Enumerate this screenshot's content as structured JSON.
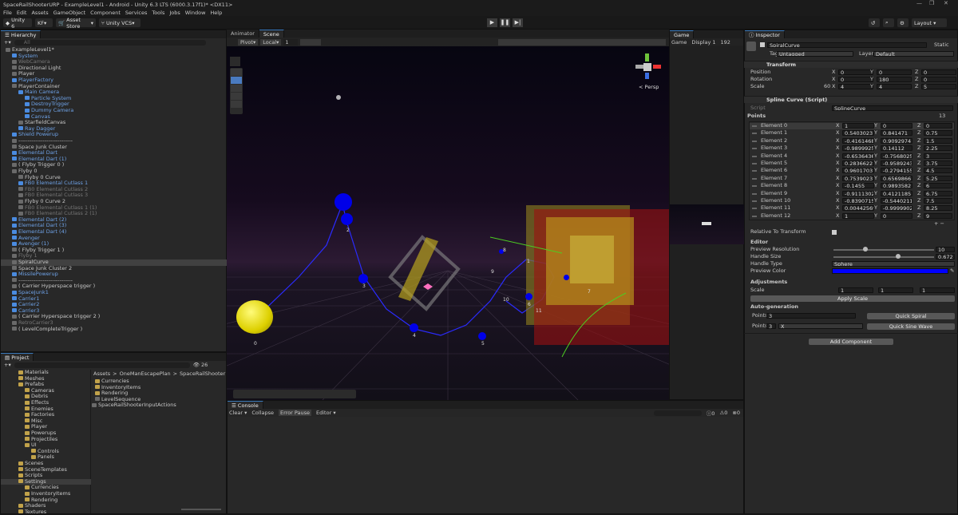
{
  "window": {
    "title": "SpaceRailShooterURP - ExampleLevel1 - Android - Unity 6.3 LTS (6000.3.17f1)* <DX11>"
  },
  "menu": [
    "File",
    "Edit",
    "Assets",
    "GameObject",
    "Component",
    "Services",
    "Tools",
    "Jobs",
    "Window",
    "Help"
  ],
  "toolbar": {
    "unity": "Unity 6",
    "kf": "KF",
    "asset_store": "Asset Store",
    "vcs": "Unity VCS",
    "layout": "Layout"
  },
  "hierarchy": {
    "tab": "Hierarchy",
    "search_placeholder": "All",
    "items": [
      {
        "t": "ExampleLevel1*",
        "d": 0,
        "c": "w"
      },
      {
        "t": "System",
        "d": 1,
        "c": "b"
      },
      {
        "t": "WebCamera",
        "d": 1,
        "c": "g"
      },
      {
        "t": "Directional Light",
        "d": 1,
        "c": "w"
      },
      {
        "t": "Player",
        "d": 1,
        "c": "w"
      },
      {
        "t": "PlayerFactory",
        "d": 1,
        "c": "b"
      },
      {
        "t": "PlayerContainer",
        "d": 1,
        "c": "w"
      },
      {
        "t": "Main Camera",
        "d": 2,
        "c": "b"
      },
      {
        "t": "Particle System",
        "d": 3,
        "c": "b"
      },
      {
        "t": "DestroyTrigger",
        "d": 3,
        "c": "b"
      },
      {
        "t": "Dummy Camera",
        "d": 3,
        "c": "b"
      },
      {
        "t": "Canvas",
        "d": 3,
        "c": "b"
      },
      {
        "t": "StarfieldCanvas",
        "d": 2,
        "c": "w"
      },
      {
        "t": "Ray Dagger",
        "d": 2,
        "c": "b"
      },
      {
        "t": "Shield Powerup",
        "d": 1,
        "c": "b"
      },
      {
        "t": "-----------------------------",
        "d": 1,
        "c": "w"
      },
      {
        "t": "Space Junk Cluster",
        "d": 1,
        "c": "w"
      },
      {
        "t": "Elemental Dart",
        "d": 1,
        "c": "b"
      },
      {
        "t": "Elemental Dart (1)",
        "d": 1,
        "c": "b"
      },
      {
        "t": "( Flyby Trigger 0 )",
        "d": 1,
        "c": "w"
      },
      {
        "t": "Flyby 0",
        "d": 1,
        "c": "w"
      },
      {
        "t": "Flyby 0 Curve",
        "d": 2,
        "c": "w"
      },
      {
        "t": "FB0 Elemental Cutlass 1",
        "d": 2,
        "c": "b"
      },
      {
        "t": "FB0 Elemental Cutlass 2",
        "d": 2,
        "c": "g"
      },
      {
        "t": "FB0 Elemental Cutlass 3",
        "d": 2,
        "c": "g"
      },
      {
        "t": "Flyby 0 Curve 2",
        "d": 2,
        "c": "w"
      },
      {
        "t": "FB0 Elemental Cutlass 1 (1)",
        "d": 2,
        "c": "g"
      },
      {
        "t": "FB0 Elemental Cutlass 2 (1)",
        "d": 2,
        "c": "g"
      },
      {
        "t": "Elemental Dart (2)",
        "d": 1,
        "c": "b"
      },
      {
        "t": "Elemental Dart (3)",
        "d": 1,
        "c": "b"
      },
      {
        "t": "Elemental Dart (4)",
        "d": 1,
        "c": "b"
      },
      {
        "t": "Avenger",
        "d": 1,
        "c": "b"
      },
      {
        "t": "Avenger (1)",
        "d": 1,
        "c": "b"
      },
      {
        "t": "( Flyby Trigger 1 )",
        "d": 1,
        "c": "w"
      },
      {
        "t": "Flyby 1",
        "d": 1,
        "c": "g"
      },
      {
        "t": "SpiralCurve",
        "d": 1,
        "c": "w",
        "sel": true
      },
      {
        "t": "Space Junk Cluster 2",
        "d": 1,
        "c": "w"
      },
      {
        "t": "MissilePowerup",
        "d": 1,
        "c": "b"
      },
      {
        "t": "-----------------------------",
        "d": 1,
        "c": "w"
      },
      {
        "t": "( Carrier Hyperspace trigger )",
        "d": 1,
        "c": "w"
      },
      {
        "t": "SpaceJunk1",
        "d": 1,
        "c": "b"
      },
      {
        "t": "Carrier1",
        "d": 1,
        "c": "b"
      },
      {
        "t": "Carrier2",
        "d": 1,
        "c": "b"
      },
      {
        "t": "Carrier3",
        "d": 1,
        "c": "b"
      },
      {
        "t": "( Carrier Hyperspace trigger 2 )",
        "d": 1,
        "c": "w"
      },
      {
        "t": "RetroCarrier3",
        "d": 1,
        "c": "g"
      },
      {
        "t": "( LevelCompleteTrigger )",
        "d": 1,
        "c": "w"
      }
    ]
  },
  "project": {
    "tab": "Project",
    "search_count": "26",
    "breadcrumb": [
      "Assets",
      "OneManEscapePlan",
      "SpaceRailShooter",
      "Settings"
    ],
    "tree": [
      {
        "t": "Materials",
        "d": 1
      },
      {
        "t": "Meshes",
        "d": 1
      },
      {
        "t": "Prefabs",
        "d": 1
      },
      {
        "t": "Cameras",
        "d": 2
      },
      {
        "t": "Debris",
        "d": 2
      },
      {
        "t": "Effects",
        "d": 2
      },
      {
        "t": "Enemies",
        "d": 2
      },
      {
        "t": "Factories",
        "d": 2
      },
      {
        "t": "Misc",
        "d": 2
      },
      {
        "t": "Player",
        "d": 2
      },
      {
        "t": "Powerups",
        "d": 2
      },
      {
        "t": "Projectiles",
        "d": 2
      },
      {
        "t": "UI",
        "d": 2
      },
      {
        "t": "Controls",
        "d": 3
      },
      {
        "t": "Panels",
        "d": 3
      },
      {
        "t": "Scenes",
        "d": 1
      },
      {
        "t": "SceneTemplates",
        "d": 1
      },
      {
        "t": "Scripts",
        "d": 1
      },
      {
        "t": "Settings",
        "d": 1,
        "sel": true
      },
      {
        "t": "Currencies",
        "d": 2
      },
      {
        "t": "InventoryItems",
        "d": 2
      },
      {
        "t": "Rendering",
        "d": 2
      },
      {
        "t": "Shaders",
        "d": 1
      },
      {
        "t": "Textures",
        "d": 1
      }
    ],
    "files": [
      "Currencies",
      "InventoryItems",
      "Rendering",
      "LevelSequence",
      "SpaceRailShooterInputActions"
    ]
  },
  "scene": {
    "tabs": [
      "Animator",
      "Scene"
    ],
    "pivot": "Pivot",
    "local": "Local",
    "grid_value": "1",
    "persp": "< Persp",
    "nodes": [
      "0",
      "1",
      "2",
      "3",
      "4",
      "5",
      "6",
      "7",
      "8",
      "9",
      "10",
      "11"
    ]
  },
  "game": {
    "tab": "Game",
    "mode": "Game",
    "display": "Display 1",
    "res": "192"
  },
  "console": {
    "tab": "Console",
    "clear": "Clear",
    "collapse": "Collapse",
    "error_pause": "Error Pause",
    "editor": "Editor",
    "counts": [
      "0",
      "0",
      "0"
    ]
  },
  "inspector": {
    "tab": "Inspector",
    "object_name": "SpiralCurve",
    "static": "Static",
    "tag_label": "Tag",
    "tag": "Untagged",
    "layer_label": "Layer",
    "layer": "Default",
    "transform": {
      "title": "Transform",
      "rows": [
        {
          "label": "Position",
          "x": "0",
          "y": "0",
          "z": "0"
        },
        {
          "label": "Rotation",
          "x": "0",
          "y": "180",
          "z": "0"
        },
        {
          "label": "Scale",
          "x": "4",
          "y": "4",
          "z": "5"
        }
      ],
      "scale_badge": "60"
    },
    "spline": {
      "title": "Spline Curve (Script)",
      "script_label": "Script",
      "script": "SplineCurve",
      "points_label": "Points",
      "points_count": "13",
      "elements": [
        {
          "n": "Element 0",
          "x": "1",
          "y": "0",
          "z": "0"
        },
        {
          "n": "Element 1",
          "x": "0.5403023",
          "y": "0.841471",
          "z": "0.75"
        },
        {
          "n": "Element 2",
          "x": "-0.4161468",
          "y": "0.9092974",
          "z": "1.5"
        },
        {
          "n": "Element 3",
          "x": "-0.9899925",
          "y": "0.14112",
          "z": "2.25"
        },
        {
          "n": "Element 4",
          "x": "-0.6536436",
          "y": "-0.7568025",
          "z": "3"
        },
        {
          "n": "Element 5",
          "x": "0.2836622",
          "y": "-0.9589243",
          "z": "3.75"
        },
        {
          "n": "Element 6",
          "x": "0.9601703",
          "y": "-0.2794155",
          "z": "4.5"
        },
        {
          "n": "Element 7",
          "x": "0.7539023",
          "y": "0.6569866",
          "z": "5.25"
        },
        {
          "n": "Element 8",
          "x": "-0.1455",
          "y": "0.9893582",
          "z": "6"
        },
        {
          "n": "Element 9",
          "x": "-0.9111302",
          "y": "0.4121185",
          "z": "6.75"
        },
        {
          "n": "Element 10",
          "x": "-0.8390715",
          "y": "-0.5440211",
          "z": "7.5"
        },
        {
          "n": "Element 11",
          "x": "0.004425698",
          "y": "-0.9999902",
          "z": "8.25"
        },
        {
          "n": "Element 12",
          "x": "1",
          "y": "0",
          "z": "9"
        }
      ],
      "relative_label": "Relative To Transform",
      "editor_label": "Editor",
      "preview_res_label": "Preview Resolution",
      "preview_res": "10",
      "handle_size_label": "Handle Size",
      "handle_size": "0.672",
      "handle_type_label": "Handle Type",
      "handle_type": "Sphere",
      "preview_color_label": "Preview Color",
      "preview_color": "#0000ff",
      "adjust_label": "Adjustments",
      "scale_label": "Scale",
      "sx": "1",
      "sy": "1",
      "sz": "1",
      "apply_scale": "Apply Scale",
      "autogen_label": "Auto-generation",
      "points2_label": "Points",
      "points2": "3",
      "quick_spiral": "Quick Spiral",
      "points3_label": "Points",
      "points3": "3",
      "axis": "X",
      "quick_sine": "Quick Sine Wave"
    },
    "add_component": "Add Component"
  }
}
